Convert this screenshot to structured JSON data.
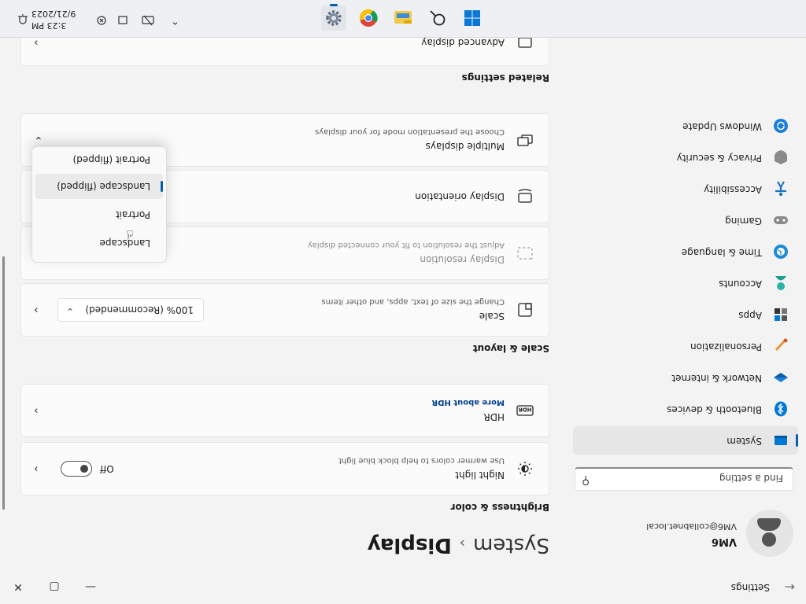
{
  "window": {
    "title": "Settings",
    "back": "←",
    "minimize": "—",
    "maximize": "▢",
    "close": "✕"
  },
  "account": {
    "name": "VM6",
    "email": "VM6@collabnet.local"
  },
  "search": {
    "placeholder": "Find a setting",
    "icon": "search-icon"
  },
  "nav": {
    "items": [
      {
        "label": "System",
        "icon": "system-icon",
        "active": true
      },
      {
        "label": "Bluetooth & devices",
        "icon": "bluetooth-icon"
      },
      {
        "label": "Network & internet",
        "icon": "network-icon"
      },
      {
        "label": "Personalization",
        "icon": "personalization-icon"
      },
      {
        "label": "Apps",
        "icon": "apps-icon"
      },
      {
        "label": "Accounts",
        "icon": "accounts-icon"
      },
      {
        "label": "Time & language",
        "icon": "time-language-icon"
      },
      {
        "label": "Gaming",
        "icon": "gaming-icon"
      },
      {
        "label": "Accessibility",
        "icon": "accessibility-icon"
      },
      {
        "label": "Privacy & security",
        "icon": "privacy-icon"
      },
      {
        "label": "Windows Update",
        "icon": "windows-update-icon"
      }
    ]
  },
  "breadcrumb": {
    "parent": "System",
    "separator": "›",
    "current": "Display"
  },
  "sections": {
    "brightness": "Brightness & color",
    "scale_layout": "Scale & layout",
    "related": "Related settings"
  },
  "night_light": {
    "title": "Night light",
    "subtitle": "Use warmer colors to help block blue light",
    "state": "Off"
  },
  "hdr": {
    "title": "HDR",
    "link": "More about HDR"
  },
  "scale": {
    "title": "Scale",
    "subtitle": "Change the size of text, apps, and other items",
    "value": "100% (Recommended)"
  },
  "resolution": {
    "title": "Display resolution",
    "subtitle": "Adjust the resolution to fit your connected display"
  },
  "orientation": {
    "title": "Display orientation",
    "options": [
      "Landscape",
      "Portrait",
      "Landscape (flipped)",
      "Portrait (flipped)"
    ],
    "selected": "Landscape (flipped)"
  },
  "multiple_displays": {
    "title": "Multiple displays",
    "subtitle": "Choose the presentation mode for your displays"
  },
  "advanced_display": {
    "title": "Advanced display"
  },
  "taskbar": {
    "apps": [
      "windows-start-icon",
      "search-icon",
      "file-explorer-icon",
      "chrome-icon",
      "settings-icon"
    ],
    "tray": [
      "chevron-up-icon",
      "network-icon",
      "volume-icon",
      "battery-icon",
      "notification-bell-icon"
    ],
    "time": "3:23 PM",
    "date": "9/21/2023"
  },
  "colors": {
    "accent": "#005fb8",
    "background": "#f3f3f3",
    "card": "#fbfbfb"
  }
}
